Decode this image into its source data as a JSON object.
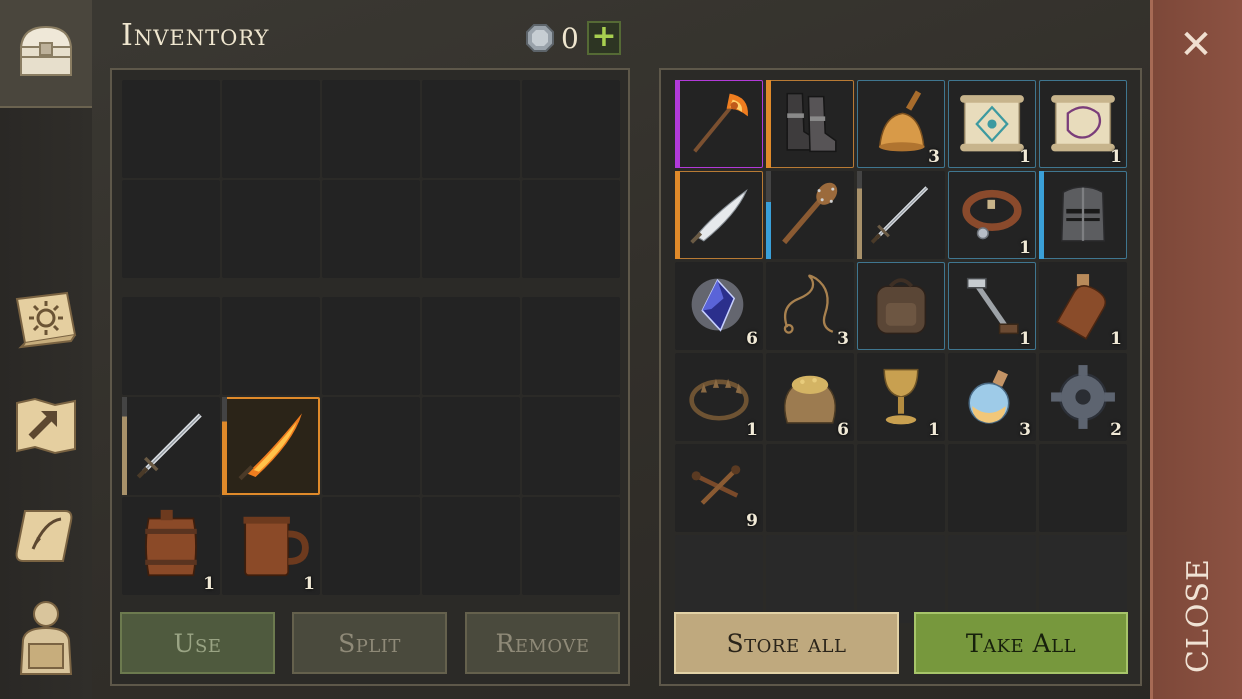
{
  "header": {
    "title": "Inventory",
    "currency_value": "0",
    "plus_label": "+"
  },
  "sidebar": {
    "items": [
      {
        "name": "chest-icon",
        "active": true
      },
      {
        "name": "sun-book-icon"
      },
      {
        "name": "map-arrow-icon"
      },
      {
        "name": "quest-scroll-icon"
      },
      {
        "name": "character-backpack-icon"
      }
    ]
  },
  "left_panel": {
    "grid_top": {
      "rows": 2,
      "cols": 5,
      "items": []
    },
    "grid_bottom": {
      "rows": 3,
      "cols": 5,
      "items": [
        {
          "row": 1,
          "col": 0,
          "icon": "longsword-icon",
          "rarity": "#a8916a",
          "durability": 0.8
        },
        {
          "row": 1,
          "col": 1,
          "icon": "flaming-sword-icon",
          "rarity": "#e08a2a",
          "durability": 0.75,
          "highlight": "#e08a2a"
        },
        {
          "row": 2,
          "col": 0,
          "icon": "barrel-icon",
          "qty": "1"
        },
        {
          "row": 2,
          "col": 1,
          "icon": "mug-icon",
          "qty": "1"
        }
      ]
    }
  },
  "right_panel": {
    "rows": 6,
    "cols": 5,
    "items": [
      {
        "row": 0,
        "col": 0,
        "icon": "flaming-axe-icon",
        "rarity": "#b23ad9",
        "border": "#b23ad9"
      },
      {
        "row": 0,
        "col": 1,
        "icon": "boots-icon",
        "rarity": "#e08a2a",
        "border": "#b87a34"
      },
      {
        "row": 0,
        "col": 2,
        "icon": "bell-icon",
        "qty": "3",
        "border": "#3f7690"
      },
      {
        "row": 0,
        "col": 3,
        "icon": "scroll-blue-icon",
        "qty": "1",
        "border": "#3f7690"
      },
      {
        "row": 0,
        "col": 4,
        "icon": "scroll-purple-icon",
        "qty": "1",
        "border": "#3f7690"
      },
      {
        "row": 1,
        "col": 0,
        "icon": "curved-sword-icon",
        "rarity": "#e08a2a",
        "border": "#b87a34"
      },
      {
        "row": 1,
        "col": 1,
        "icon": "spiked-club-icon",
        "rarity": "#3aa0d8",
        "durability": 0.65
      },
      {
        "row": 1,
        "col": 2,
        "icon": "longsword-icon",
        "rarity": "#a8916a",
        "durability": 0.8
      },
      {
        "row": 1,
        "col": 3,
        "icon": "collar-icon",
        "qty": "1",
        "border": "#3f7690"
      },
      {
        "row": 1,
        "col": 4,
        "icon": "knight-helmet-icon",
        "rarity": "#3aa0d8",
        "border": "#3f7690"
      },
      {
        "row": 2,
        "col": 0,
        "icon": "crystal-icon",
        "qty": "6"
      },
      {
        "row": 2,
        "col": 1,
        "icon": "rope-icon",
        "qty": "3"
      },
      {
        "row": 2,
        "col": 2,
        "icon": "backpack-icon",
        "border": "#3f7690"
      },
      {
        "row": 2,
        "col": 3,
        "icon": "crank-icon",
        "qty": "1",
        "border": "#3f7690"
      },
      {
        "row": 2,
        "col": 4,
        "icon": "bottle-icon",
        "qty": "1"
      },
      {
        "row": 3,
        "col": 0,
        "icon": "bear-trap-icon",
        "qty": "1"
      },
      {
        "row": 3,
        "col": 1,
        "icon": "grain-sack-icon",
        "qty": "6"
      },
      {
        "row": 3,
        "col": 2,
        "icon": "goblet-icon",
        "qty": "1"
      },
      {
        "row": 3,
        "col": 3,
        "icon": "potion-icon",
        "qty": "3"
      },
      {
        "row": 3,
        "col": 4,
        "icon": "gear-icon",
        "qty": "2"
      },
      {
        "row": 4,
        "col": 0,
        "icon": "nails-icon",
        "qty": "9"
      }
    ]
  },
  "buttons": {
    "use": "Use",
    "split": "Split",
    "remove": "Remove",
    "store_all": "Store all",
    "take_all": "Take All",
    "close": "CLOSE"
  },
  "colors": {
    "store_all_bg": "#bfa97e",
    "take_all_bg": "#77983d",
    "close_strip_bg": "#8c5242"
  }
}
